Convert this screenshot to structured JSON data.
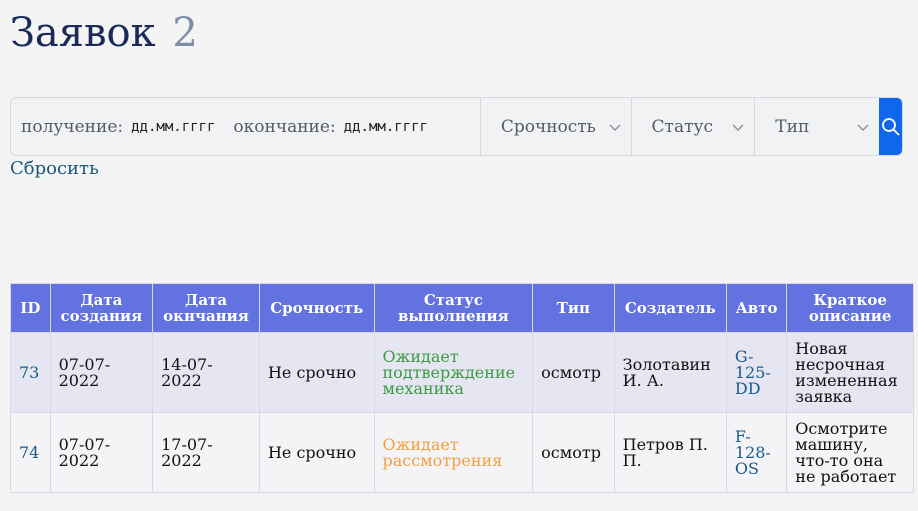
{
  "header": {
    "title": "Заявок",
    "count": "2"
  },
  "filters": {
    "received_label": "получение:",
    "received_value": "дд.мм.гггг",
    "ending_label": "окончание:",
    "ending_value": "дд.мм.гггг",
    "urgency": "Срочность",
    "status": "Статус",
    "type": "Тип",
    "reset": "Сбросить"
  },
  "table": {
    "headers": [
      "ID",
      "Дата создания",
      "Дата окнчания",
      "Срочность",
      "Статус выполнения",
      "Тип",
      "Создатель",
      "Авто",
      "Краткое описание"
    ],
    "rows": [
      {
        "id": "73",
        "created": "07-07-2022",
        "ends": "14-07-2022",
        "urgency": "Не срочно",
        "status": "Ожидает подтверждение механика",
        "type": "осмотр",
        "creator": "Золотавин И. А.",
        "car": "G-125-DD",
        "description": "Новая несрочная измененная заявка"
      },
      {
        "id": "74",
        "created": "07-07-2022",
        "ends": "17-07-2022",
        "urgency": "Не срочно",
        "status": "Ожидает рассмотрения",
        "type": "осмотр",
        "creator": "Петров П. П.",
        "car": "F-128-OS",
        "description": "Осмотрите машину, что-то она не работает"
      }
    ]
  },
  "colors": {
    "header_bg": "#6272e0",
    "status_awaiting_mechanic": "#3c9a46",
    "status_awaiting_review": "#f0a040",
    "search_button": "#1166ee"
  }
}
